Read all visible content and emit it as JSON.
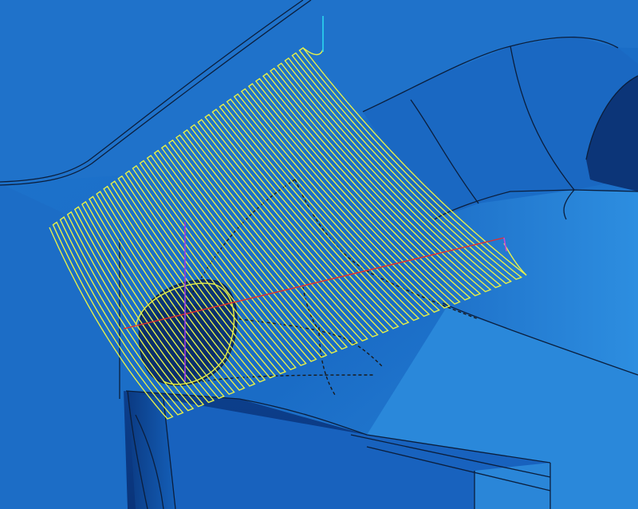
{
  "viewport": {
    "view_type": "3d-cad-toolpath-view"
  },
  "colors": {
    "surface_light": "#2a86d8",
    "surface_mid": "#1766c2",
    "surface_dark": "#0a3f8a",
    "edge": "#0b1e3c",
    "toolpath": "#e6f04a",
    "lead_in": "#2ad6f0",
    "axis_red": "#e0302f",
    "axis_purple": "#9a3de0",
    "axis_magenta": "#c24ad6"
  },
  "icons": {
    "toolpath": "zigzag-toolpath-icon"
  }
}
